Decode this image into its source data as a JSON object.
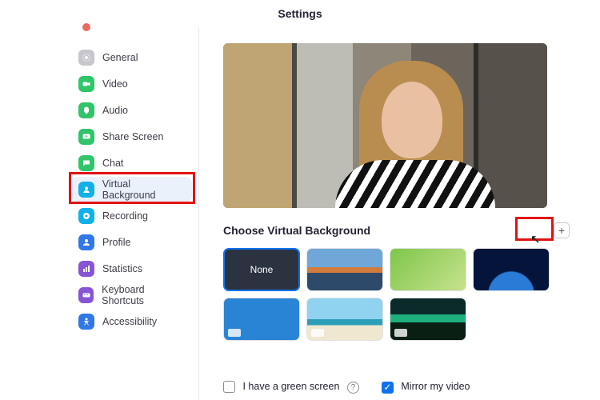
{
  "title": "Settings",
  "colors": {
    "accent": "#0e72ed",
    "highlight": "#e11212",
    "close_dot": "#ec6a5e"
  },
  "sidebar": {
    "items": [
      {
        "label": "General",
        "icon": "gear-icon",
        "active": false,
        "bg": "#c6c6cc"
      },
      {
        "label": "Video",
        "icon": "video-icon",
        "active": false,
        "bg": "#2fc568"
      },
      {
        "label": "Audio",
        "icon": "audio-icon",
        "active": false,
        "bg": "#2fc568"
      },
      {
        "label": "Share Screen",
        "icon": "share-icon",
        "active": false,
        "bg": "#2fc568"
      },
      {
        "label": "Chat",
        "icon": "chat-icon",
        "active": false,
        "bg": "#2fc568"
      },
      {
        "label": "Virtual Background",
        "icon": "background-icon",
        "active": true,
        "bg": "#10b1e8"
      },
      {
        "label": "Recording",
        "icon": "record-icon",
        "active": false,
        "bg": "#10b1e8"
      },
      {
        "label": "Profile",
        "icon": "profile-icon",
        "active": false,
        "bg": "#3077e8"
      },
      {
        "label": "Statistics",
        "icon": "stats-icon",
        "active": false,
        "bg": "#8754d6"
      },
      {
        "label": "Keyboard Shortcuts",
        "icon": "keyboard-icon",
        "active": false,
        "bg": "#8754d6"
      },
      {
        "label": "Accessibility",
        "icon": "accessibility-icon",
        "active": false,
        "bg": "#3077e8"
      }
    ]
  },
  "main": {
    "section_title": "Choose Virtual Background",
    "add_button_label": "+",
    "backgrounds": [
      {
        "name": "None",
        "label": "None",
        "selected": true,
        "style": "#2b3340"
      },
      {
        "name": "Golden Gate",
        "label": "",
        "selected": false,
        "style": "linear-gradient(180deg,#6fa8d8 0 44%,#d37b3b 44% 58%,#2e4a6a 58% 100%)"
      },
      {
        "name": "Grass",
        "label": "",
        "selected": false,
        "style": "linear-gradient(135deg,#7fc64a,#c7e28e)"
      },
      {
        "name": "Earth",
        "label": "",
        "selected": false,
        "style": "radial-gradient(circle at 50% 110%, #2a7bd6 0 38%, #05143a 40% 100%)"
      },
      {
        "name": "Blue pattern",
        "label": "",
        "selected": false,
        "style": "#2a84d6",
        "video": true
      },
      {
        "name": "Beach",
        "label": "",
        "selected": false,
        "style": "linear-gradient(180deg,#8fd3f0 0 50%,#2c9fb8 50% 64%,#efe7cf 64% 100%)",
        "video": true
      },
      {
        "name": "Aurora",
        "label": "",
        "selected": false,
        "style": "linear-gradient(180deg,#0b2a2a 0 38%,#1fae7d 38% 58%,#0a1f14 58% 100%)",
        "video": true
      }
    ],
    "checkboxes": {
      "green_screen": {
        "label": "I have a green screen",
        "checked": false
      },
      "mirror": {
        "label": "Mirror my video",
        "checked": true
      }
    }
  }
}
